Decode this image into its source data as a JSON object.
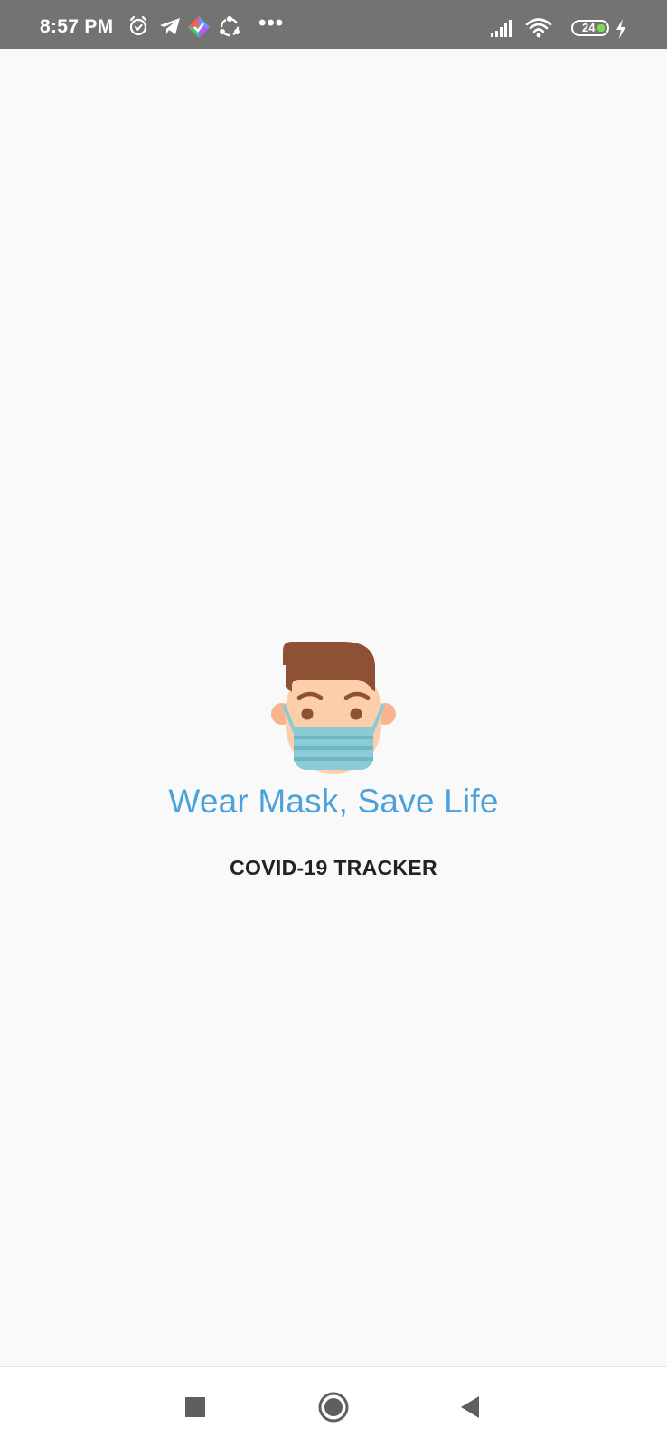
{
  "status_bar": {
    "time": "8:57 PM",
    "icons": [
      "alarm-icon",
      "telegram-icon",
      "app-notification-icon",
      "share-icon",
      "more-dots-icon",
      "signal-icon",
      "wifi-icon",
      "battery-icon",
      "charging-icon"
    ],
    "more_dots": "•••",
    "battery_level": "24"
  },
  "splash": {
    "illustration": "masked-face-icon",
    "slogan": "Wear Mask, Save Life",
    "app_name": "COVID-19 TRACKER"
  },
  "nav_bar": {
    "buttons": [
      "recents-square-icon",
      "home-circle-icon",
      "back-triangle-icon"
    ]
  },
  "colors": {
    "status_bar_bg": "#737373",
    "background": "#f9f9f9",
    "slogan": "#4aa1dc",
    "app_name": "#222222",
    "hair": "#8e5135",
    "skin": "#fccfaa",
    "mask": "#8acbd5"
  }
}
